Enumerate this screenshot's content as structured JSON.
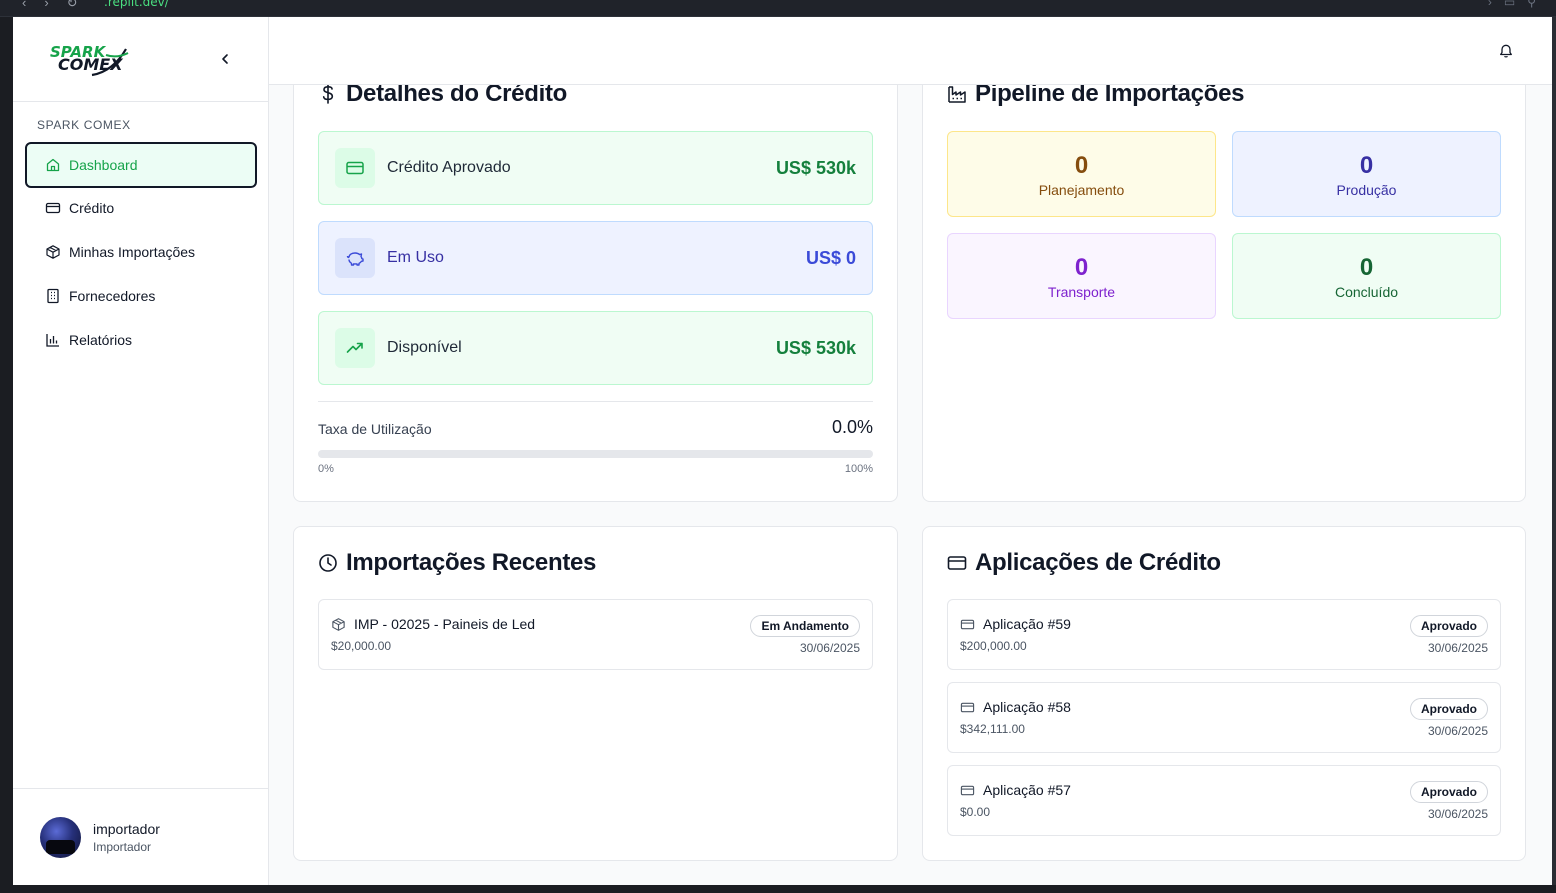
{
  "browser": {
    "url": ".replit.dev/"
  },
  "sidebar": {
    "logo_top": "SPARK",
    "logo_bottom": "COMEX",
    "section_label": "SPARK COMEX",
    "items": [
      {
        "label": "Dashboard",
        "icon": "home-icon",
        "active": true
      },
      {
        "label": "Crédito",
        "icon": "credit-card-icon"
      },
      {
        "label": "Minhas Importações",
        "icon": "package-icon"
      },
      {
        "label": "Fornecedores",
        "icon": "building-icon"
      },
      {
        "label": "Relatórios",
        "icon": "bar-chart-icon"
      }
    ],
    "user": {
      "name": "importador",
      "role": "Importador"
    }
  },
  "credit_details": {
    "title": "Detalhes do Crédito",
    "approved": {
      "label": "Crédito Aprovado",
      "value": "US$ 530k"
    },
    "in_use": {
      "label": "Em Uso",
      "value": "US$ 0"
    },
    "available": {
      "label": "Disponível",
      "value": "US$ 530k"
    },
    "utilization": {
      "label": "Taxa de Utilização",
      "value": "0.0%",
      "fraction": 0.0,
      "min_label": "0%",
      "max_label": "100%"
    }
  },
  "pipeline": {
    "title": "Pipeline de Importações",
    "stages": [
      {
        "count": "0",
        "label": "Planejamento"
      },
      {
        "count": "0",
        "label": "Produção"
      },
      {
        "count": "0",
        "label": "Transporte"
      },
      {
        "count": "0",
        "label": "Concluído"
      }
    ]
  },
  "recent_imports": {
    "title": "Importações Recentes",
    "items": [
      {
        "name": "IMP - 02025 - Paineis de Led",
        "amount": "$20,000.00",
        "status": "Em Andamento",
        "date": "30/06/2025"
      }
    ]
  },
  "credit_applications": {
    "title": "Aplicações de Crédito",
    "items": [
      {
        "name": "Aplicação #59",
        "amount": "$200,000.00",
        "status": "Aprovado",
        "date": "30/06/2025"
      },
      {
        "name": "Aplicação #58",
        "amount": "$342,111.00",
        "status": "Aprovado",
        "date": "30/06/2025"
      },
      {
        "name": "Aplicação #57",
        "amount": "$0.00",
        "status": "Aprovado",
        "date": "30/06/2025"
      }
    ]
  },
  "colors": {
    "brand": "#16a34a",
    "active_bg": "#ecfdf5"
  }
}
